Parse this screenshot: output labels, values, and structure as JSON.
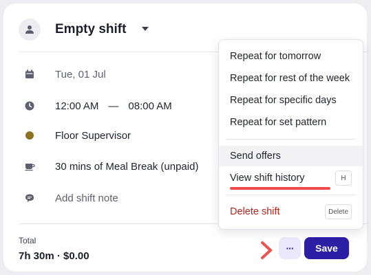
{
  "header": {
    "title": "Empty shift",
    "avatar_icon": "user-icon",
    "caret_icon": "caret-down-icon"
  },
  "details": {
    "date": "Tue, 01 Jul",
    "start_time": "12:00 AM",
    "time_separator": "—",
    "end_time": "08:00 AM",
    "role": "Floor Supervisor",
    "role_color": "#8e7421",
    "break": "30 mins of Meal Break (unpaid)",
    "note_placeholder": "Add shift note"
  },
  "footer": {
    "total_label": "Total",
    "total_value": "7h 30m · $0.00",
    "more_label": "···",
    "save_label": "Save",
    "save_color": "#2c1fa6"
  },
  "menu": {
    "repeat_tomorrow": "Repeat for tomorrow",
    "repeat_week": "Repeat for rest of the week",
    "repeat_specific": "Repeat for specific days",
    "repeat_pattern": "Repeat for set pattern",
    "send_offers": "Send offers",
    "view_history": "View shift history",
    "view_history_shortcut": "H",
    "delete_shift": "Delete shift",
    "delete_shortcut": "Delete",
    "danger_color": "#b3261e"
  }
}
